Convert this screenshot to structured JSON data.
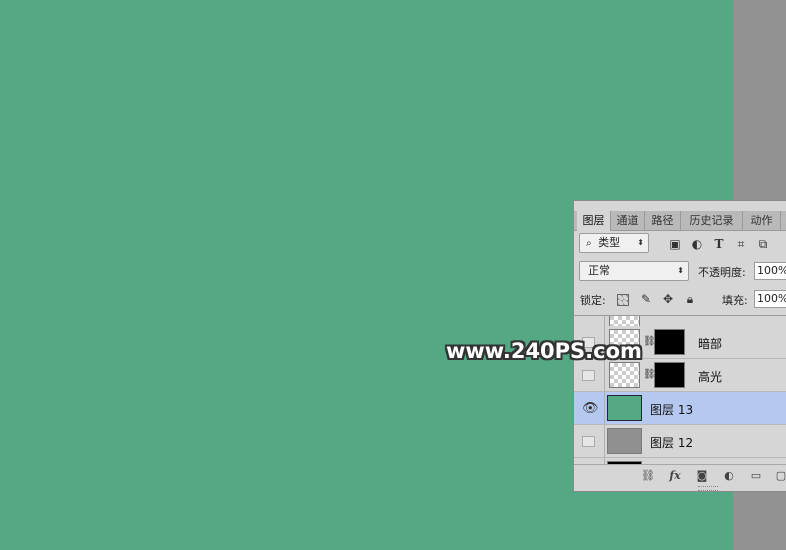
{
  "canvas": {
    "fill_color": "#54a984",
    "pasteboard_color": "#929292"
  },
  "layers_panel": {
    "tabs": [
      {
        "label": "图层",
        "active": true
      },
      {
        "label": "通道",
        "active": false
      },
      {
        "label": "路径",
        "active": false
      },
      {
        "label": "历史记录",
        "active": false
      },
      {
        "label": "动作",
        "active": false
      }
    ],
    "filter": {
      "icon": "search-icon",
      "kind_label": "类型"
    },
    "filter_icons": [
      "image-filter-icon",
      "adjustment-filter-icon",
      "type-filter-icon",
      "shape-filter-icon",
      "smart-object-filter-icon"
    ],
    "blend_mode": "正常",
    "opacity_label": "不透明度:",
    "opacity_value": "100%",
    "lock_label": "锁定:",
    "lock_icons": [
      "lock-transparent-icon",
      "lock-pixels-icon",
      "lock-position-icon",
      "lock-all-icon"
    ],
    "fill_label": "填充:",
    "fill_value": "100%",
    "layers": [
      {
        "name": "暗部",
        "visible": false,
        "thumb": "checker",
        "has_mask": true,
        "selected": false
      },
      {
        "name": "高光",
        "visible": false,
        "thumb": "checker",
        "has_mask": true,
        "selected": false
      },
      {
        "name": "图层 13",
        "visible": true,
        "thumb_color": "#54a984",
        "has_mask": false,
        "selected": true
      },
      {
        "name": "图层 12",
        "visible": false,
        "thumb_color": "#909090",
        "has_mask": false,
        "selected": false
      }
    ],
    "bottom_icons": [
      "link-layers-icon",
      "fx-icon",
      "add-mask-icon",
      "adjustment-layer-icon",
      "new-group-icon",
      "new-layer-icon"
    ],
    "fx_label": "fx"
  },
  "watermark": "www.240PS.com"
}
